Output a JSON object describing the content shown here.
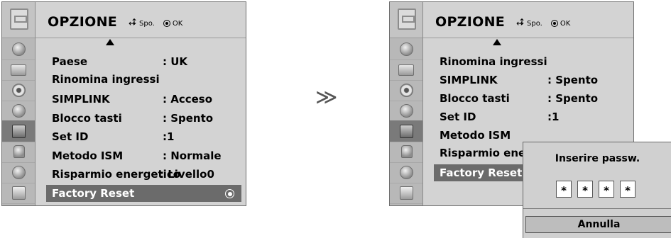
{
  "left_menu": {
    "title": "OPZIONE",
    "hints": {
      "move_label": "Spo.",
      "ok_label": "OK"
    },
    "items": [
      {
        "label": "Paese",
        "value": ": UK"
      },
      {
        "label": "Rinomina ingressi",
        "value": ""
      },
      {
        "label": "SIMPLINK",
        "value": ": Acceso"
      },
      {
        "label": "Blocco tasti",
        "value": ": Spento"
      },
      {
        "label": "Set ID",
        "value": ":1"
      },
      {
        "label": "Metodo ISM",
        "value": ": Normale"
      },
      {
        "label": "Risparmio energetico",
        "value": ": Livello0"
      },
      {
        "label": "Factory Reset",
        "value": ""
      }
    ]
  },
  "transition_arrow": "≫",
  "right_menu": {
    "title": "OPZIONE",
    "hints": {
      "move_label": "Spo.",
      "ok_label": "OK"
    },
    "items": [
      {
        "label": "Rinomina ingressi",
        "value": ""
      },
      {
        "label": "SIMPLINK",
        "value": ": Spento"
      },
      {
        "label": "Blocco tasti",
        "value": ": Spento"
      },
      {
        "label": "Set ID",
        "value": ":1"
      },
      {
        "label": "Metodo ISM",
        "value": ""
      },
      {
        "label": "Risparmio energ",
        "value": ""
      },
      {
        "label": "Factory Reset",
        "value": ""
      }
    ]
  },
  "password_popup": {
    "title": "Inserire passw.",
    "digits": [
      "*",
      "*",
      "*",
      "*"
    ],
    "cancel_label": "Annulla"
  }
}
